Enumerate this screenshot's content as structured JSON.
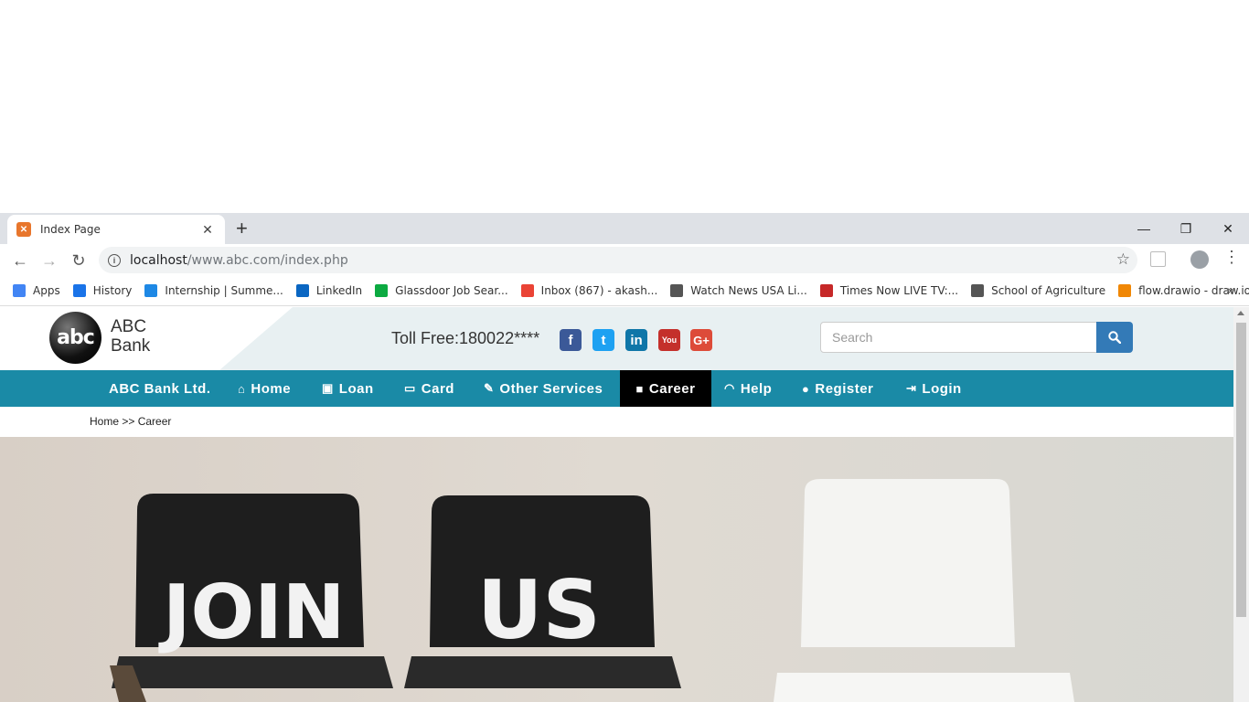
{
  "browser": {
    "tab_title": "Index Page",
    "url_host": "localhost",
    "url_path": "/www.abc.com/index.php",
    "bookmarks": [
      {
        "label": "Apps",
        "icon": "apps-grid-icon",
        "color": "#4285f4"
      },
      {
        "label": "History",
        "icon": "history-icon",
        "color": "#1a73e8"
      },
      {
        "label": "Internship | Summe...",
        "icon": "internshala-icon",
        "color": "#1e88e5"
      },
      {
        "label": "LinkedIn",
        "icon": "linkedin-icon",
        "color": "#0a66c2"
      },
      {
        "label": "Glassdoor Job Sear...",
        "icon": "glassdoor-icon",
        "color": "#0caa41"
      },
      {
        "label": "Inbox (867) - akash...",
        "icon": "google-icon",
        "color": "#ea4335"
      },
      {
        "label": "Watch News USA Li...",
        "icon": "globe-icon",
        "color": "#555555"
      },
      {
        "label": "Times Now LIVE TV:...",
        "icon": "times-now-icon",
        "color": "#c62828"
      },
      {
        "label": "School of Agriculture",
        "icon": "globe-icon",
        "color": "#555555"
      },
      {
        "label": "flow.drawio - draw.io",
        "icon": "drawio-icon",
        "color": "#f08705"
      }
    ]
  },
  "site": {
    "logo_mark": "abc",
    "logo_line1": "ABC",
    "logo_line2": "Bank",
    "toll_free": "Toll Free:180022****",
    "search_placeholder": "Search",
    "social": [
      {
        "name": "facebook-icon",
        "glyph": "f",
        "color": "#3b5998"
      },
      {
        "name": "twitter-icon",
        "glyph": "t",
        "color": "#1da1f2"
      },
      {
        "name": "linkedin-icon",
        "glyph": "in",
        "color": "#0e76a8"
      },
      {
        "name": "youtube-icon",
        "glyph": "You",
        "color": "#c4302b"
      },
      {
        "name": "google-plus-icon",
        "glyph": "G+",
        "color": "#dd4b39"
      }
    ],
    "nav": [
      {
        "label": "ABC Bank Ltd.",
        "icon": ""
      },
      {
        "label": "Home",
        "icon": "⌂"
      },
      {
        "label": "Loan",
        "icon": "▣"
      },
      {
        "label": "Card",
        "icon": "▭"
      },
      {
        "label": "Other Services",
        "icon": "✎"
      },
      {
        "label": "Career",
        "icon": "■"
      },
      {
        "label": "Help",
        "icon": "◠"
      },
      {
        "label": "Register",
        "icon": "●"
      },
      {
        "label": "Login",
        "icon": "⇥"
      }
    ],
    "active_nav": "Career",
    "breadcrumb": "Home >> Career",
    "hero_text_1": "JOIN",
    "hero_text_2": "US"
  },
  "colors": {
    "nav_bg": "#1a8aa6",
    "nav_active": "#000000",
    "search_btn": "#337ab7"
  }
}
